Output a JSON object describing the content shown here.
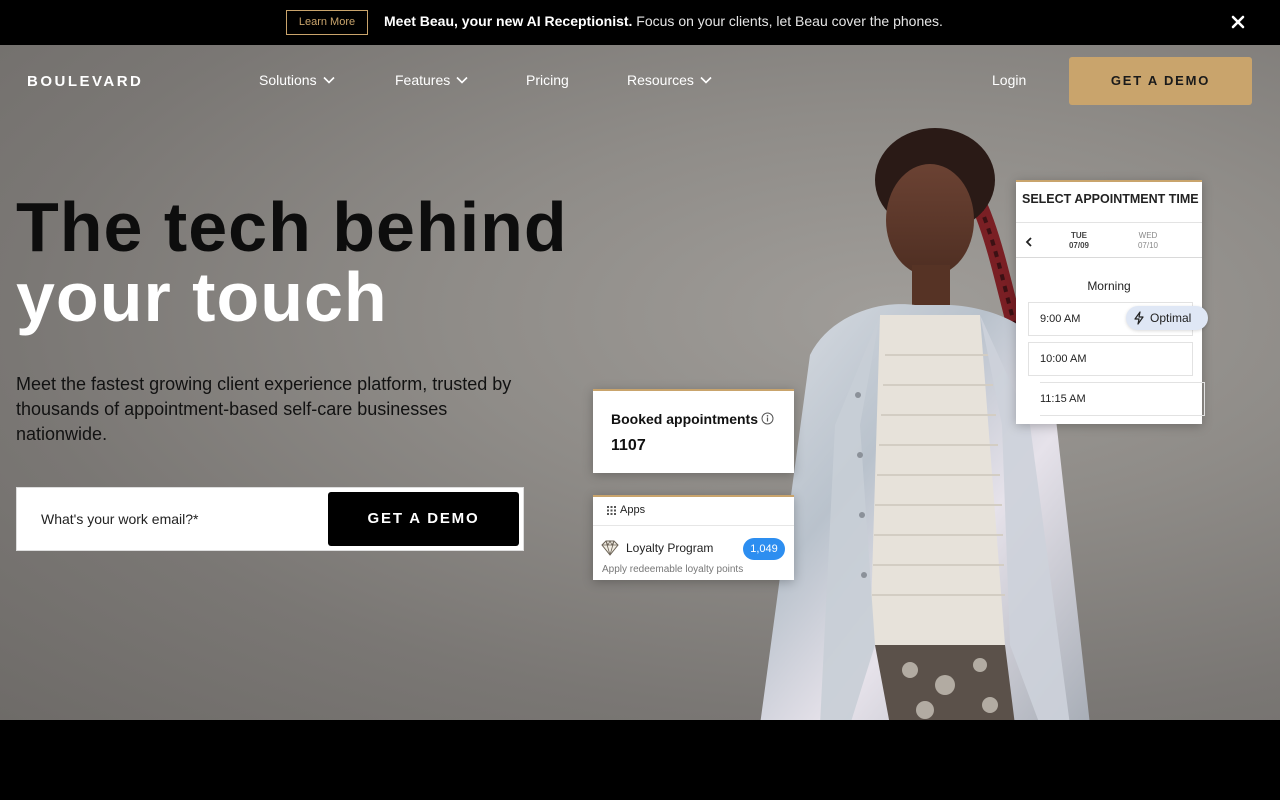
{
  "announcement": {
    "learn_label": "Learn More",
    "headline": "Meet Beau, your new AI Receptionist.",
    "message": " Focus on your clients, let Beau cover the phones."
  },
  "nav": {
    "logo": "BOULEVARD",
    "items": [
      {
        "label": "Solutions",
        "dropdown": true
      },
      {
        "label": "Features",
        "dropdown": true
      },
      {
        "label": "Pricing",
        "dropdown": false
      },
      {
        "label": "Resources",
        "dropdown": true
      }
    ],
    "login": "Login",
    "cta": "GET A DEMO"
  },
  "hero": {
    "title_line1": "The tech behind",
    "title_line2": "your touch",
    "subtitle": "Meet the fastest growing client experience platform, trusted by thousands of appointment-based self-care businesses nationwide.",
    "email_placeholder": "What's your work email?*",
    "cta": "GET A DEMO"
  },
  "cards": {
    "booked": {
      "title": "Booked appointments",
      "value": "1107"
    },
    "apps": {
      "heading": "Apps",
      "item_label": "Loyalty Program",
      "item_count": "1,049",
      "item_desc": "Apply redeemable loyalty points"
    },
    "schedule": {
      "title": "SELECT APPOINTMENT TIME",
      "days": [
        {
          "name": "TUE",
          "date": "07/09"
        },
        {
          "name": "WED",
          "date": "07/10"
        }
      ],
      "period": "Morning",
      "slots": [
        "9:00 AM",
        "10:00 AM",
        "11:15 AM"
      ],
      "optimal_label": "Optimal"
    }
  },
  "colors": {
    "accent": "#c9a46c",
    "badge_blue": "#2d8ef0",
    "announcement_bg": "#000000"
  },
  "icons": [
    "close-icon",
    "chevron-down-icon",
    "info-icon",
    "grid-icon",
    "gem-icon",
    "chevron-left-icon",
    "bolt-icon"
  ]
}
